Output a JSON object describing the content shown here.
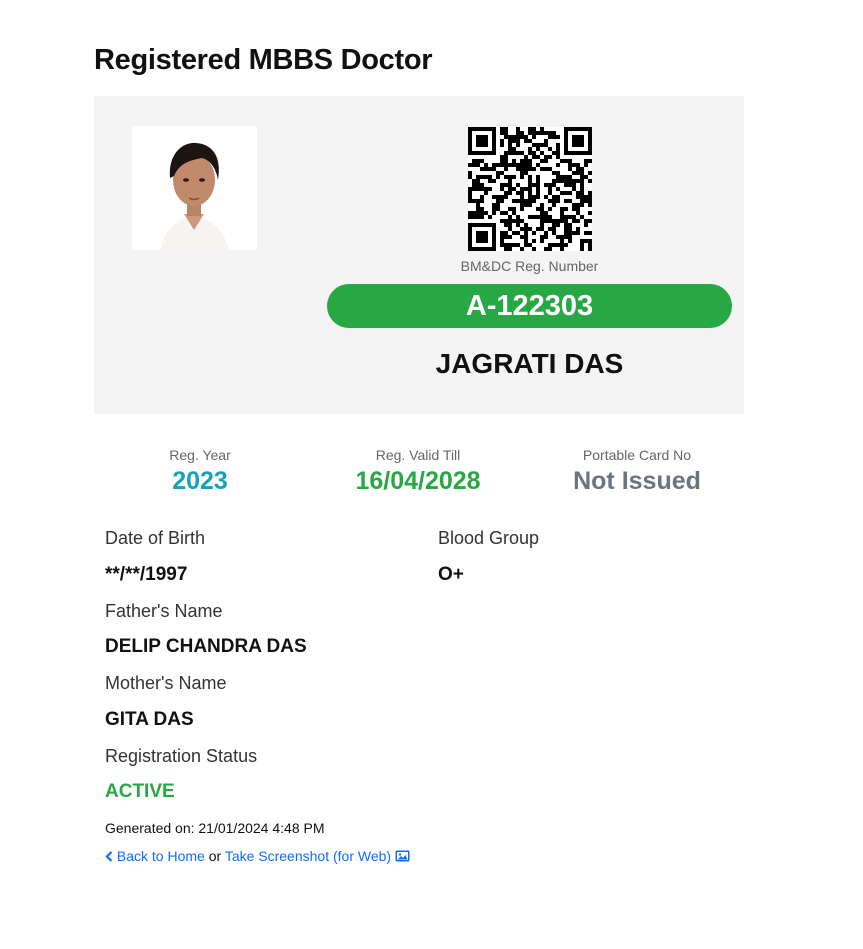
{
  "page": {
    "title": "Registered MBBS Doctor"
  },
  "card": {
    "reg_label": "BM&DC Reg. Number",
    "reg_number": "A-122303",
    "doctor_name": "JAGRATI DAS",
    "photo_icon": "doctor-photo",
    "qr_icon": "qr-code-icon"
  },
  "stats": [
    {
      "label": "Reg. Year",
      "value": "2023",
      "color": "#17a2b8"
    },
    {
      "label": "Reg. Valid Till",
      "value": "16/04/2028",
      "color": "#28a745"
    },
    {
      "label": "Portable Card No",
      "value": "Not Issued",
      "color": "#6c757d"
    }
  ],
  "details": {
    "dob_label": "Date of Birth",
    "dob_value": "**/**/1997",
    "blood_label": "Blood Group",
    "blood_value": "O+",
    "father_label": "Father's Name",
    "father_value": "DELIP CHANDRA DAS",
    "mother_label": "Mother's Name",
    "mother_value": "GITA DAS",
    "status_label": "Registration Status",
    "status_value": "ACTIVE"
  },
  "footer": {
    "generated": "Generated on: 21/01/2024 4:48 PM",
    "back_label": "Back to Home",
    "or_text": "or",
    "screenshot_label": "Take Screenshot (for Web)",
    "back_icon": "chevron-left-icon",
    "screenshot_icon": "image-icon"
  },
  "colors": {
    "accent_green": "#28a745",
    "accent_teal": "#17a2b8",
    "muted_grey": "#6c757d",
    "link_blue": "#0d6efd",
    "card_bg": "#f4f4f4"
  }
}
